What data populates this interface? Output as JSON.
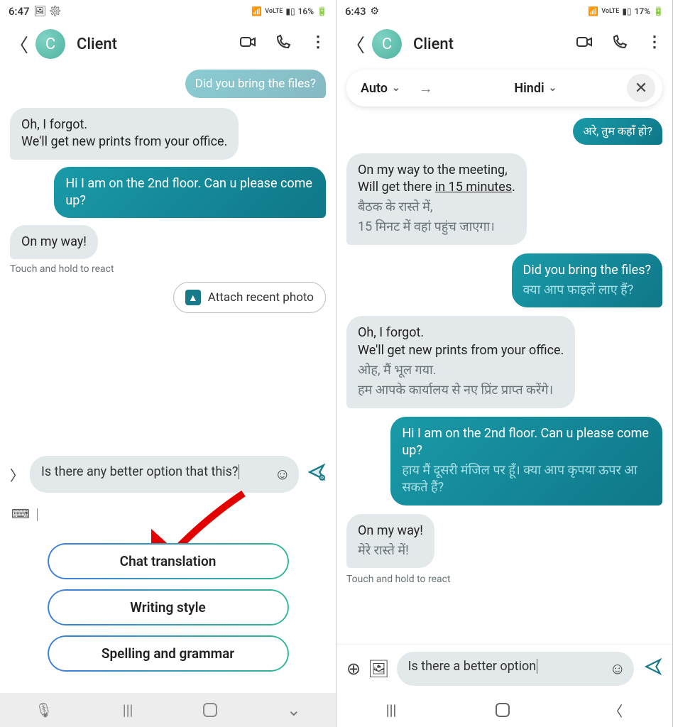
{
  "left": {
    "status": {
      "time": "6:47",
      "icons": "🖼 ⚙",
      "battery": "16%",
      "signal": "📶",
      "wifi": "Wi-Fi",
      "lte": "VoLTE"
    },
    "header": {
      "avatar": "C",
      "name": "Client"
    },
    "icons": {
      "video": "video",
      "call": "call",
      "more": "⋮"
    },
    "messages": {
      "faded_out": "Did you bring the files?",
      "m1": "Oh, I forgot.\nWe'll get new prints from your office.",
      "m2": "Hi I am on the 2nd floor. Can u please come up?",
      "m3": "On my way!",
      "hint": "Touch and hold to react"
    },
    "attach": "Attach recent photo",
    "input": "Is there any better option that this?",
    "options": {
      "o1": "Chat translation",
      "o2": "Writing style",
      "o3": "Spelling and grammar"
    },
    "botbar": {
      "mic": "🎤",
      "recents": "|||",
      "home": "▢",
      "back": "⌄"
    }
  },
  "right": {
    "status": {
      "time": "6:43",
      "icons": "⚙",
      "battery": "17%",
      "signal": "📶",
      "lte": "VoLTE"
    },
    "header": {
      "avatar": "C",
      "name": "Client"
    },
    "translate": {
      "from": "Auto",
      "to": "Hindi",
      "arrow": "→",
      "close": "✕"
    },
    "messages": {
      "m0_out": "अरे, तुम कहाँ हो?",
      "m1_en1": "On my way to the meeting,",
      "m1_en2a": "Will get there ",
      "m1_en2b": "in 15 minutes",
      "m1_en2c": ".",
      "m1_hi1": "बैठक के रास्ते में,",
      "m1_hi2": "15 मिनट में वहां पहुंच जाएगा।",
      "m2_en": "Did you bring the files?",
      "m2_hi": "क्या आप फाइलें लाए हैं?",
      "m3_en": "Oh, I forgot.\nWe'll get new prints from your office.",
      "m3_hi1": "ओह, मैं भूल गया.",
      "m3_hi2": "हम आपके कार्यालय से नए प्रिंट प्राप्त करेंगे।",
      "m4_en": "Hi I am on the 2nd floor. Can u please come up?",
      "m4_hi": "हाय मैं दूसरी मंजिल पर हूँ। क्या आप कृपया ऊपर आ सकते हैं?",
      "m5_en": "On my way!",
      "m5_hi": "मेरे रास्ते में!",
      "hint": "Touch and hold to react"
    },
    "input": "Is there a better option",
    "botbar": {
      "recents": "|||",
      "home": "▢",
      "back": "〈"
    }
  }
}
